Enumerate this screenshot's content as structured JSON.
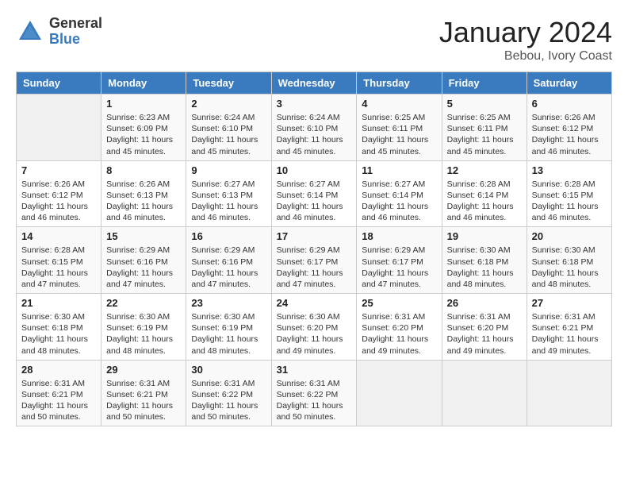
{
  "header": {
    "logo_general": "General",
    "logo_blue": "Blue",
    "month_title": "January 2024",
    "location": "Bebou, Ivory Coast"
  },
  "weekdays": [
    "Sunday",
    "Monday",
    "Tuesday",
    "Wednesday",
    "Thursday",
    "Friday",
    "Saturday"
  ],
  "weeks": [
    [
      {
        "day": "",
        "empty": true
      },
      {
        "day": "1",
        "sunrise": "Sunrise: 6:23 AM",
        "sunset": "Sunset: 6:09 PM",
        "daylight": "Daylight: 11 hours and 45 minutes."
      },
      {
        "day": "2",
        "sunrise": "Sunrise: 6:24 AM",
        "sunset": "Sunset: 6:10 PM",
        "daylight": "Daylight: 11 hours and 45 minutes."
      },
      {
        "day": "3",
        "sunrise": "Sunrise: 6:24 AM",
        "sunset": "Sunset: 6:10 PM",
        "daylight": "Daylight: 11 hours and 45 minutes."
      },
      {
        "day": "4",
        "sunrise": "Sunrise: 6:25 AM",
        "sunset": "Sunset: 6:11 PM",
        "daylight": "Daylight: 11 hours and 45 minutes."
      },
      {
        "day": "5",
        "sunrise": "Sunrise: 6:25 AM",
        "sunset": "Sunset: 6:11 PM",
        "daylight": "Daylight: 11 hours and 45 minutes."
      },
      {
        "day": "6",
        "sunrise": "Sunrise: 6:26 AM",
        "sunset": "Sunset: 6:12 PM",
        "daylight": "Daylight: 11 hours and 46 minutes."
      }
    ],
    [
      {
        "day": "7",
        "sunrise": "Sunrise: 6:26 AM",
        "sunset": "Sunset: 6:12 PM",
        "daylight": "Daylight: 11 hours and 46 minutes."
      },
      {
        "day": "8",
        "sunrise": "Sunrise: 6:26 AM",
        "sunset": "Sunset: 6:13 PM",
        "daylight": "Daylight: 11 hours and 46 minutes."
      },
      {
        "day": "9",
        "sunrise": "Sunrise: 6:27 AM",
        "sunset": "Sunset: 6:13 PM",
        "daylight": "Daylight: 11 hours and 46 minutes."
      },
      {
        "day": "10",
        "sunrise": "Sunrise: 6:27 AM",
        "sunset": "Sunset: 6:14 PM",
        "daylight": "Daylight: 11 hours and 46 minutes."
      },
      {
        "day": "11",
        "sunrise": "Sunrise: 6:27 AM",
        "sunset": "Sunset: 6:14 PM",
        "daylight": "Daylight: 11 hours and 46 minutes."
      },
      {
        "day": "12",
        "sunrise": "Sunrise: 6:28 AM",
        "sunset": "Sunset: 6:14 PM",
        "daylight": "Daylight: 11 hours and 46 minutes."
      },
      {
        "day": "13",
        "sunrise": "Sunrise: 6:28 AM",
        "sunset": "Sunset: 6:15 PM",
        "daylight": "Daylight: 11 hours and 46 minutes."
      }
    ],
    [
      {
        "day": "14",
        "sunrise": "Sunrise: 6:28 AM",
        "sunset": "Sunset: 6:15 PM",
        "daylight": "Daylight: 11 hours and 47 minutes."
      },
      {
        "day": "15",
        "sunrise": "Sunrise: 6:29 AM",
        "sunset": "Sunset: 6:16 PM",
        "daylight": "Daylight: 11 hours and 47 minutes."
      },
      {
        "day": "16",
        "sunrise": "Sunrise: 6:29 AM",
        "sunset": "Sunset: 6:16 PM",
        "daylight": "Daylight: 11 hours and 47 minutes."
      },
      {
        "day": "17",
        "sunrise": "Sunrise: 6:29 AM",
        "sunset": "Sunset: 6:17 PM",
        "daylight": "Daylight: 11 hours and 47 minutes."
      },
      {
        "day": "18",
        "sunrise": "Sunrise: 6:29 AM",
        "sunset": "Sunset: 6:17 PM",
        "daylight": "Daylight: 11 hours and 47 minutes."
      },
      {
        "day": "19",
        "sunrise": "Sunrise: 6:30 AM",
        "sunset": "Sunset: 6:18 PM",
        "daylight": "Daylight: 11 hours and 48 minutes."
      },
      {
        "day": "20",
        "sunrise": "Sunrise: 6:30 AM",
        "sunset": "Sunset: 6:18 PM",
        "daylight": "Daylight: 11 hours and 48 minutes."
      }
    ],
    [
      {
        "day": "21",
        "sunrise": "Sunrise: 6:30 AM",
        "sunset": "Sunset: 6:18 PM",
        "daylight": "Daylight: 11 hours and 48 minutes."
      },
      {
        "day": "22",
        "sunrise": "Sunrise: 6:30 AM",
        "sunset": "Sunset: 6:19 PM",
        "daylight": "Daylight: 11 hours and 48 minutes."
      },
      {
        "day": "23",
        "sunrise": "Sunrise: 6:30 AM",
        "sunset": "Sunset: 6:19 PM",
        "daylight": "Daylight: 11 hours and 48 minutes."
      },
      {
        "day": "24",
        "sunrise": "Sunrise: 6:30 AM",
        "sunset": "Sunset: 6:20 PM",
        "daylight": "Daylight: 11 hours and 49 minutes."
      },
      {
        "day": "25",
        "sunrise": "Sunrise: 6:31 AM",
        "sunset": "Sunset: 6:20 PM",
        "daylight": "Daylight: 11 hours and 49 minutes."
      },
      {
        "day": "26",
        "sunrise": "Sunrise: 6:31 AM",
        "sunset": "Sunset: 6:20 PM",
        "daylight": "Daylight: 11 hours and 49 minutes."
      },
      {
        "day": "27",
        "sunrise": "Sunrise: 6:31 AM",
        "sunset": "Sunset: 6:21 PM",
        "daylight": "Daylight: 11 hours and 49 minutes."
      }
    ],
    [
      {
        "day": "28",
        "sunrise": "Sunrise: 6:31 AM",
        "sunset": "Sunset: 6:21 PM",
        "daylight": "Daylight: 11 hours and 50 minutes."
      },
      {
        "day": "29",
        "sunrise": "Sunrise: 6:31 AM",
        "sunset": "Sunset: 6:21 PM",
        "daylight": "Daylight: 11 hours and 50 minutes."
      },
      {
        "day": "30",
        "sunrise": "Sunrise: 6:31 AM",
        "sunset": "Sunset: 6:22 PM",
        "daylight": "Daylight: 11 hours and 50 minutes."
      },
      {
        "day": "31",
        "sunrise": "Sunrise: 6:31 AM",
        "sunset": "Sunset: 6:22 PM",
        "daylight": "Daylight: 11 hours and 50 minutes."
      },
      {
        "day": "",
        "empty": true
      },
      {
        "day": "",
        "empty": true
      },
      {
        "day": "",
        "empty": true
      }
    ]
  ]
}
